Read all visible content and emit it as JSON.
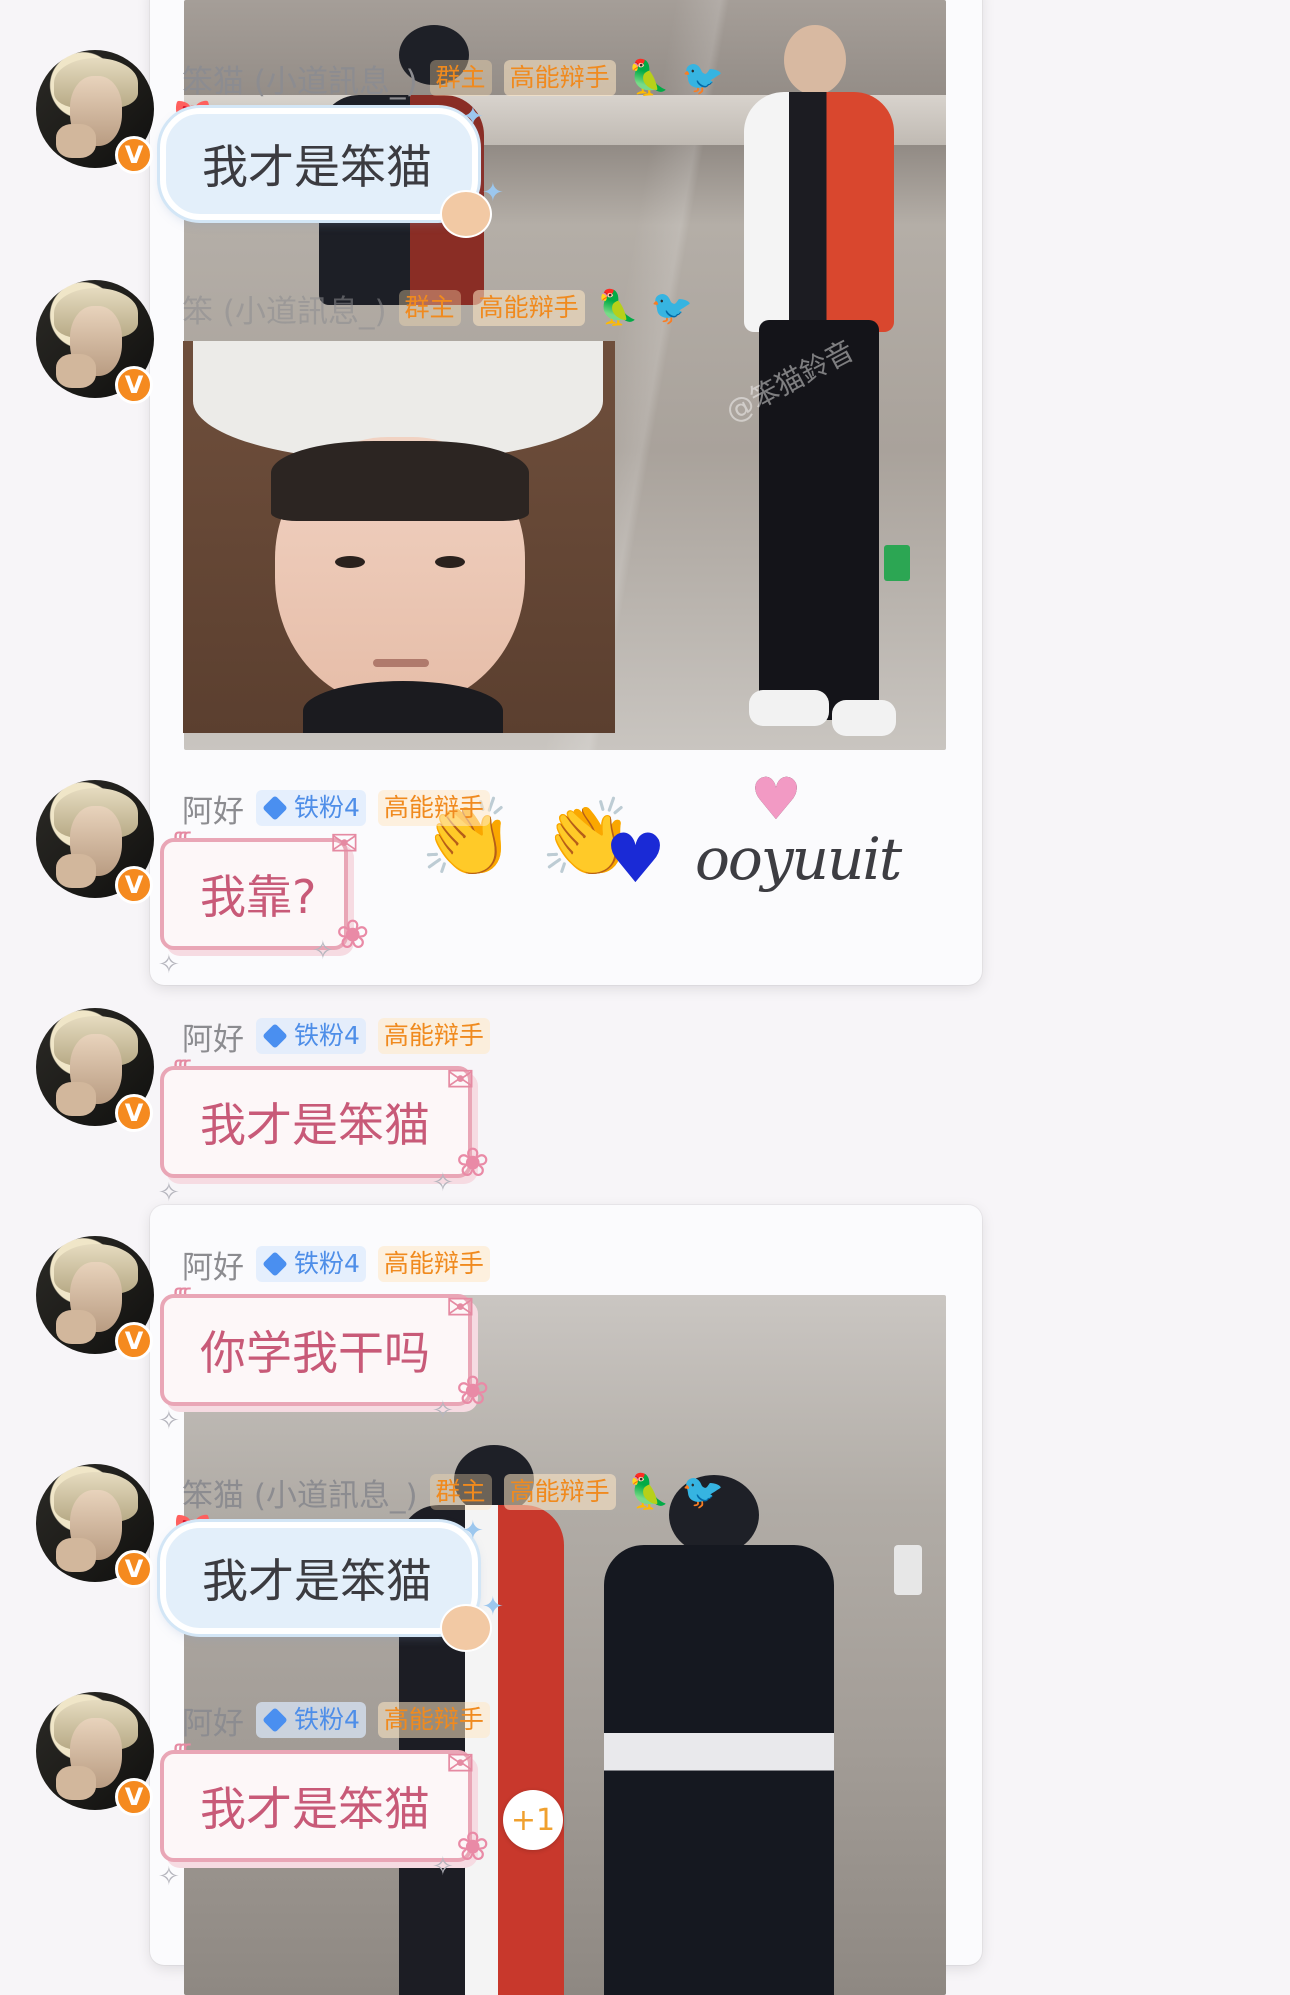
{
  "messages": [
    {
      "nickname": "笨猫 (小道訊息_)",
      "tags": [
        "群主",
        "高能辩手"
      ],
      "text": "我才是笨猫",
      "bubble_style": "blue"
    },
    {
      "nickname": "笨 (小道訊息_)",
      "tags": [
        "群主",
        "高能辩手"
      ],
      "text": "",
      "bubble_style": "image"
    },
    {
      "nickname": "阿好",
      "fan_badge": "铁粉4",
      "tags": [
        "高能辩手"
      ],
      "text": "我靠?",
      "bubble_style": "pink"
    },
    {
      "nickname": "阿好",
      "fan_badge": "铁粉4",
      "tags": [
        "高能辩手"
      ],
      "text": "我才是笨猫",
      "bubble_style": "pink"
    },
    {
      "nickname": "阿好",
      "fan_badge": "铁粉4",
      "tags": [
        "高能辩手"
      ],
      "text": "你学我干吗",
      "bubble_style": "pink"
    },
    {
      "nickname": "笨猫 (小道訊息_)",
      "tags": [
        "群主",
        "高能辩手"
      ],
      "text": "我才是笨猫",
      "bubble_style": "blue"
    },
    {
      "nickname": "阿好",
      "fan_badge": "铁粉4",
      "tags": [
        "高能辩手"
      ],
      "text": "我才是笨猫",
      "bubble_style": "pink",
      "reaction": "+1"
    }
  ],
  "verify_badge": "V",
  "watermark": "@笨猫鈴音",
  "signature": "ooyuuit",
  "icons": {
    "avatar": "avatar-image",
    "verify": "verified-v-badge",
    "bird": "bird-emoji",
    "fan": "diamond-icon",
    "clap": "clapping-hands-emoji",
    "heart_pink": "pink-heart-emoji",
    "heart_blue": "blue-heart-emoji"
  },
  "colors": {
    "verify_orange": "#f58a1f",
    "tag_orange": "#f08a1e",
    "fan_blue": "#4e8ee8",
    "bubble_blue": "#e3effa",
    "bubble_pink_text": "#c85a78",
    "heart_pink": "#f29ac4",
    "heart_blue": "#1a2ad6"
  }
}
